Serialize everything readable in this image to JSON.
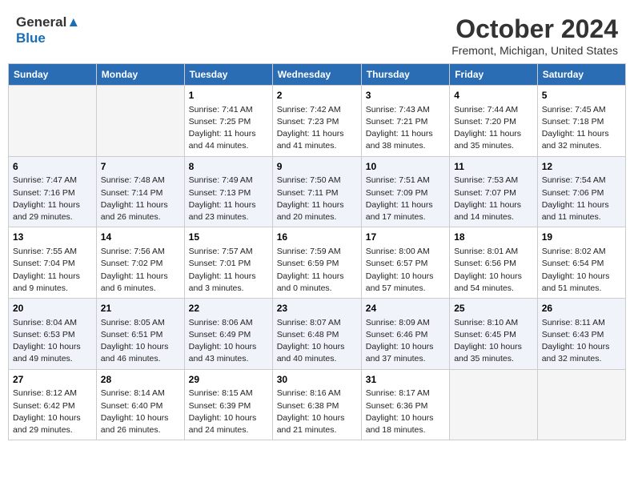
{
  "logo": {
    "line1": "General",
    "line2": "Blue"
  },
  "title": "October 2024",
  "subtitle": "Fremont, Michigan, United States",
  "headers": [
    "Sunday",
    "Monday",
    "Tuesday",
    "Wednesday",
    "Thursday",
    "Friday",
    "Saturday"
  ],
  "weeks": [
    [
      {
        "day": "",
        "sunrise": "",
        "sunset": "",
        "daylight": ""
      },
      {
        "day": "",
        "sunrise": "",
        "sunset": "",
        "daylight": ""
      },
      {
        "day": "1",
        "sunrise": "Sunrise: 7:41 AM",
        "sunset": "Sunset: 7:25 PM",
        "daylight": "Daylight: 11 hours and 44 minutes."
      },
      {
        "day": "2",
        "sunrise": "Sunrise: 7:42 AM",
        "sunset": "Sunset: 7:23 PM",
        "daylight": "Daylight: 11 hours and 41 minutes."
      },
      {
        "day": "3",
        "sunrise": "Sunrise: 7:43 AM",
        "sunset": "Sunset: 7:21 PM",
        "daylight": "Daylight: 11 hours and 38 minutes."
      },
      {
        "day": "4",
        "sunrise": "Sunrise: 7:44 AM",
        "sunset": "Sunset: 7:20 PM",
        "daylight": "Daylight: 11 hours and 35 minutes."
      },
      {
        "day": "5",
        "sunrise": "Sunrise: 7:45 AM",
        "sunset": "Sunset: 7:18 PM",
        "daylight": "Daylight: 11 hours and 32 minutes."
      }
    ],
    [
      {
        "day": "6",
        "sunrise": "Sunrise: 7:47 AM",
        "sunset": "Sunset: 7:16 PM",
        "daylight": "Daylight: 11 hours and 29 minutes."
      },
      {
        "day": "7",
        "sunrise": "Sunrise: 7:48 AM",
        "sunset": "Sunset: 7:14 PM",
        "daylight": "Daylight: 11 hours and 26 minutes."
      },
      {
        "day": "8",
        "sunrise": "Sunrise: 7:49 AM",
        "sunset": "Sunset: 7:13 PM",
        "daylight": "Daylight: 11 hours and 23 minutes."
      },
      {
        "day": "9",
        "sunrise": "Sunrise: 7:50 AM",
        "sunset": "Sunset: 7:11 PM",
        "daylight": "Daylight: 11 hours and 20 minutes."
      },
      {
        "day": "10",
        "sunrise": "Sunrise: 7:51 AM",
        "sunset": "Sunset: 7:09 PM",
        "daylight": "Daylight: 11 hours and 17 minutes."
      },
      {
        "day": "11",
        "sunrise": "Sunrise: 7:53 AM",
        "sunset": "Sunset: 7:07 PM",
        "daylight": "Daylight: 11 hours and 14 minutes."
      },
      {
        "day": "12",
        "sunrise": "Sunrise: 7:54 AM",
        "sunset": "Sunset: 7:06 PM",
        "daylight": "Daylight: 11 hours and 11 minutes."
      }
    ],
    [
      {
        "day": "13",
        "sunrise": "Sunrise: 7:55 AM",
        "sunset": "Sunset: 7:04 PM",
        "daylight": "Daylight: 11 hours and 9 minutes."
      },
      {
        "day": "14",
        "sunrise": "Sunrise: 7:56 AM",
        "sunset": "Sunset: 7:02 PM",
        "daylight": "Daylight: 11 hours and 6 minutes."
      },
      {
        "day": "15",
        "sunrise": "Sunrise: 7:57 AM",
        "sunset": "Sunset: 7:01 PM",
        "daylight": "Daylight: 11 hours and 3 minutes."
      },
      {
        "day": "16",
        "sunrise": "Sunrise: 7:59 AM",
        "sunset": "Sunset: 6:59 PM",
        "daylight": "Daylight: 11 hours and 0 minutes."
      },
      {
        "day": "17",
        "sunrise": "Sunrise: 8:00 AM",
        "sunset": "Sunset: 6:57 PM",
        "daylight": "Daylight: 10 hours and 57 minutes."
      },
      {
        "day": "18",
        "sunrise": "Sunrise: 8:01 AM",
        "sunset": "Sunset: 6:56 PM",
        "daylight": "Daylight: 10 hours and 54 minutes."
      },
      {
        "day": "19",
        "sunrise": "Sunrise: 8:02 AM",
        "sunset": "Sunset: 6:54 PM",
        "daylight": "Daylight: 10 hours and 51 minutes."
      }
    ],
    [
      {
        "day": "20",
        "sunrise": "Sunrise: 8:04 AM",
        "sunset": "Sunset: 6:53 PM",
        "daylight": "Daylight: 10 hours and 49 minutes."
      },
      {
        "day": "21",
        "sunrise": "Sunrise: 8:05 AM",
        "sunset": "Sunset: 6:51 PM",
        "daylight": "Daylight: 10 hours and 46 minutes."
      },
      {
        "day": "22",
        "sunrise": "Sunrise: 8:06 AM",
        "sunset": "Sunset: 6:49 PM",
        "daylight": "Daylight: 10 hours and 43 minutes."
      },
      {
        "day": "23",
        "sunrise": "Sunrise: 8:07 AM",
        "sunset": "Sunset: 6:48 PM",
        "daylight": "Daylight: 10 hours and 40 minutes."
      },
      {
        "day": "24",
        "sunrise": "Sunrise: 8:09 AM",
        "sunset": "Sunset: 6:46 PM",
        "daylight": "Daylight: 10 hours and 37 minutes."
      },
      {
        "day": "25",
        "sunrise": "Sunrise: 8:10 AM",
        "sunset": "Sunset: 6:45 PM",
        "daylight": "Daylight: 10 hours and 35 minutes."
      },
      {
        "day": "26",
        "sunrise": "Sunrise: 8:11 AM",
        "sunset": "Sunset: 6:43 PM",
        "daylight": "Daylight: 10 hours and 32 minutes."
      }
    ],
    [
      {
        "day": "27",
        "sunrise": "Sunrise: 8:12 AM",
        "sunset": "Sunset: 6:42 PM",
        "daylight": "Daylight: 10 hours and 29 minutes."
      },
      {
        "day": "28",
        "sunrise": "Sunrise: 8:14 AM",
        "sunset": "Sunset: 6:40 PM",
        "daylight": "Daylight: 10 hours and 26 minutes."
      },
      {
        "day": "29",
        "sunrise": "Sunrise: 8:15 AM",
        "sunset": "Sunset: 6:39 PM",
        "daylight": "Daylight: 10 hours and 24 minutes."
      },
      {
        "day": "30",
        "sunrise": "Sunrise: 8:16 AM",
        "sunset": "Sunset: 6:38 PM",
        "daylight": "Daylight: 10 hours and 21 minutes."
      },
      {
        "day": "31",
        "sunrise": "Sunrise: 8:17 AM",
        "sunset": "Sunset: 6:36 PM",
        "daylight": "Daylight: 10 hours and 18 minutes."
      },
      {
        "day": "",
        "sunrise": "",
        "sunset": "",
        "daylight": ""
      },
      {
        "day": "",
        "sunrise": "",
        "sunset": "",
        "daylight": ""
      }
    ]
  ]
}
